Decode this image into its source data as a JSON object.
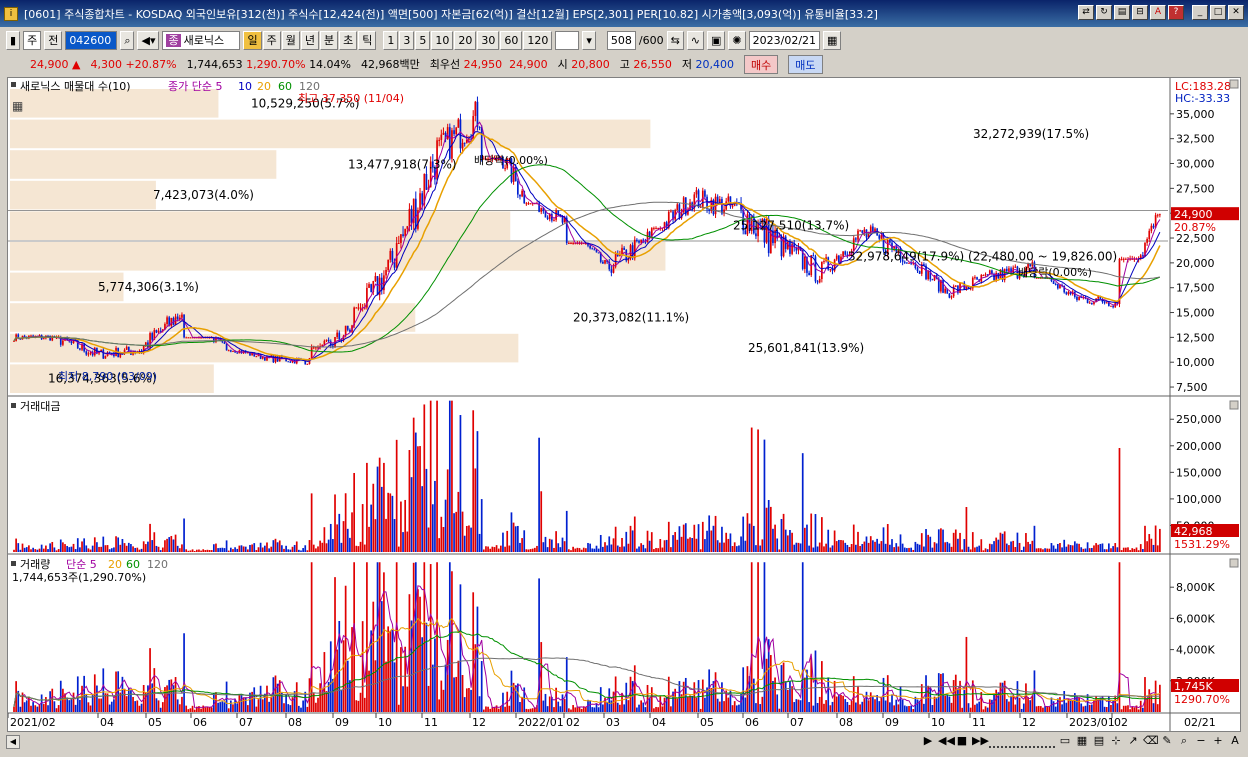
{
  "window": {
    "title": "[0601] 주식종합차트 - KOSDAQ 외국인보유[312(천)] 주식수[12,424(천)] 액면[500] 자본금[62(억)] 결산[12월] EPS[2,301] PER[10.82] 시가총액[3,093(억)] 유통비율[33.2]"
  },
  "toolbar": {
    "market": "주",
    "all": "전",
    "code": "042600",
    "stock_name_tag": "종",
    "stock_name": "새로닉스",
    "periods": [
      "일",
      "주",
      "월",
      "년",
      "분",
      "초",
      "틱"
    ],
    "active_period": "일",
    "intervals": [
      "1",
      "3",
      "5",
      "10",
      "20",
      "30",
      "60",
      "120"
    ],
    "count": "508",
    "count_total": "/600",
    "date": "2023/02/21"
  },
  "quote": {
    "price": "24,900",
    "change_arrow": "▲",
    "change": "4,300",
    "change_pct": "+20.87%",
    "volume": "1,744,653",
    "volume_pct": "1,290.70%",
    "turnover": "14.04%",
    "amount": "42,968백만",
    "best_label": "최우선",
    "best_ask": "24,950",
    "best_bid": "24,900",
    "open_label": "시",
    "open": "20,800",
    "high_label": "고",
    "high": "26,550",
    "low_label": "저",
    "low": "20,400",
    "buy_label": "매수",
    "sell_label": "매도"
  },
  "colors": {
    "up": "#e00000",
    "down": "#0020d0",
    "ma5": "#a000a0",
    "ma10": "#0000c0",
    "ma20": "#e8a000",
    "ma60": "#009000",
    "ma120": "#707070",
    "volume_profile": "#f5e6d3"
  },
  "chart_data": [
    {
      "type": "candlestick",
      "panel": "price",
      "legend": [
        "새로닉스 매물대 수(10)",
        "종가 단순 5",
        "10",
        "20",
        "60",
        "120"
      ],
      "lc_label": "LC:183.28",
      "hc_label": "HC:-33.33",
      "y_ticks": [
        "35,000",
        "32,500",
        "30,000",
        "27,500",
        "25,000",
        "22,500",
        "20,000",
        "17,500",
        "15,000",
        "12,500",
        "10,000",
        "7,500"
      ],
      "ylim": [
        6800,
        37600
      ],
      "price_label": "24,900",
      "price_pct_label": "20.87%",
      "high_annotation": "최고 37,350 (11/04)",
      "low_annotation": "최저 8,790 (03/09)",
      "dividend_annotations": [
        "배당락(0.00%)",
        "배당락(0.00%)"
      ],
      "volume_profile": [
        {
          "low": 6800,
          "high": 9880,
          "label": "16,374,363(5.6%)",
          "share": 0.176
        },
        {
          "low": 9880,
          "high": 12960,
          "label": "25,601,841(13.9%)",
          "share": 0.439
        },
        {
          "low": 12960,
          "high": 16040,
          "label": "20,373,082(11.1%)",
          "share": 0.35
        },
        {
          "low": 16040,
          "high": 19120,
          "label": "5,774,306(3.1%)",
          "share": 0.098
        },
        {
          "low": 19120,
          "high": 22200,
          "label": "32,978,649(17.9%) (22,480.00 ~ 19,826.00)",
          "share": 0.566
        },
        {
          "low": 22200,
          "high": 25280,
          "label": "25,127,510(13.7%)",
          "share": 0.432
        },
        {
          "low": 25280,
          "high": 28360,
          "label": "7,423,073(4.0%)",
          "share": 0.126
        },
        {
          "low": 28360,
          "high": 31440,
          "label": "13,477,918(7.3%)",
          "share": 0.23
        },
        {
          "low": 31440,
          "high": 34520,
          "label": "32,272,939(17.5%)",
          "share": 0.553
        },
        {
          "low": 34520,
          "high": 37600,
          "label": "10,529,250(5.7%)",
          "share": 0.18
        }
      ],
      "month_closes": [
        12500,
        10800,
        11200,
        15000,
        11500,
        10400,
        10100,
        13500,
        20500,
        31000,
        35000,
        27000,
        24000,
        19500,
        22500,
        26500,
        25500,
        22000,
        19000,
        23000,
        21000,
        17000,
        18500,
        19500,
        16500,
        16000,
        24900
      ],
      "month_highs": [
        13500,
        12500,
        13200,
        16500,
        12500,
        11200,
        11800,
        16500,
        24500,
        36000,
        37350,
        30500,
        26000,
        22000,
        25000,
        29500,
        28500,
        31500,
        24500,
        25000,
        24000,
        20000,
        21000,
        21500,
        18500,
        18000,
        26550
      ],
      "month_lows": [
        11500,
        8790,
        10000,
        11000,
        10000,
        9600,
        9700,
        11500,
        15500,
        22000,
        27000,
        23500,
        21500,
        18500,
        19000,
        23500,
        22000,
        20500,
        17000,
        19000,
        17500,
        16000,
        16500,
        17000,
        15500,
        14700,
        20400
      ]
    },
    {
      "type": "bar",
      "panel": "amount",
      "legend": [
        "거래대금"
      ],
      "y_ticks": [
        "250,000",
        "200,000",
        "150,000",
        "100,000",
        "50,000"
      ],
      "ylim": [
        0,
        290000
      ],
      "last_value_label": "42,968",
      "last_pct_label": "1531.29%"
    },
    {
      "type": "bar",
      "panel": "volume",
      "legend": [
        "거래량",
        "단순 5",
        "20",
        "60",
        "120"
      ],
      "subtitle": "1,744,653주(1,290.70%)",
      "y_ticks": [
        "8,000K",
        "6,000K",
        "4,000K",
        "2,000K"
      ],
      "ylim": [
        0,
        10000
      ],
      "last_value_label": "1,745K",
      "last_pct_label": "1290.70%"
    }
  ],
  "x_axis": {
    "labels": [
      "2021/02",
      "04",
      "05",
      "06",
      "07",
      "08",
      "09",
      "10",
      "11",
      "12",
      "2022/01",
      "02",
      "03",
      "04",
      "05",
      "06",
      "07",
      "08",
      "09",
      "10",
      "11",
      "12",
      "2023/01",
      "02"
    ],
    "date_label": "02/21"
  }
}
